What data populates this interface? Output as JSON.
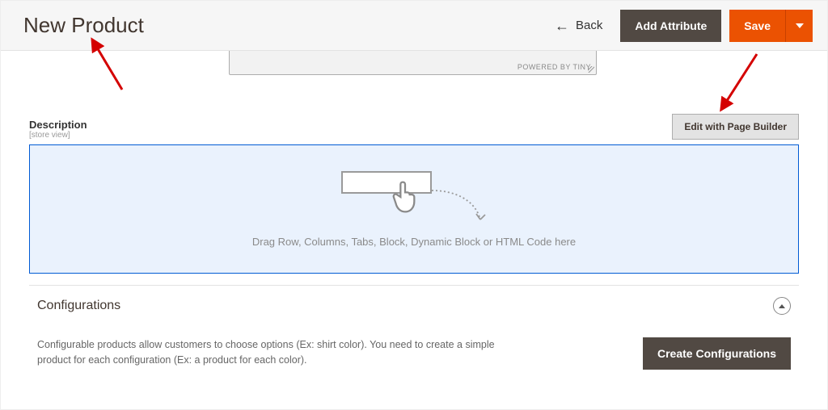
{
  "header": {
    "title": "New Product",
    "back_label": "Back",
    "add_attribute_label": "Add Attribute",
    "save_label": "Save"
  },
  "prev_editor": {
    "powered_by": "POWERED BY TINY"
  },
  "description": {
    "label": "Description",
    "scope": "[store view]",
    "edit_button": "Edit with Page Builder",
    "dropzone_hint": "Drag Row, Columns, Tabs, Block, Dynamic Block or HTML Code here"
  },
  "configurations": {
    "title": "Configurations",
    "help_text": "Configurable products allow customers to choose options (Ex: shirt color). You need to create a simple product for each configuration (Ex: a product for each color).",
    "create_button": "Create Configurations"
  },
  "colors": {
    "accent": "#eb5202",
    "dark_button": "#514943",
    "dropzone_bg": "#eaf2fd",
    "dropzone_border": "#005bd4"
  }
}
